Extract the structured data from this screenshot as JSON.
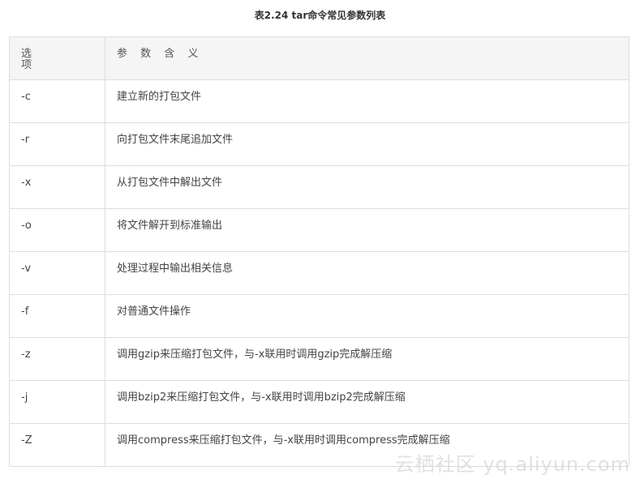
{
  "caption": "表2.24 tar命令常见参数列表",
  "table": {
    "headers": [
      "选 项",
      "参 数 含 义"
    ],
    "rows": [
      {
        "option": "-c",
        "meaning": "建立新的打包文件"
      },
      {
        "option": "-r",
        "meaning": "向打包文件末尾追加文件"
      },
      {
        "option": "-x",
        "meaning": "从打包文件中解出文件"
      },
      {
        "option": "-o",
        "meaning": "将文件解开到标准输出"
      },
      {
        "option": "-v",
        "meaning": "处理过程中输出相关信息"
      },
      {
        "option": "-f",
        "meaning": "对普通文件操作"
      },
      {
        "option": "-z",
        "meaning": "调用gzip来压缩打包文件，与-x联用时调用gzip完成解压缩"
      },
      {
        "option": "-j",
        "meaning": "调用bzip2来压缩打包文件，与-x联用时调用bzip2完成解压缩"
      },
      {
        "option": "-Z",
        "meaning": "调用compress来压缩打包文件，与-x联用时调用compress完成解压缩"
      }
    ]
  },
  "watermark": "云栖社区 yq.aliyun.com"
}
